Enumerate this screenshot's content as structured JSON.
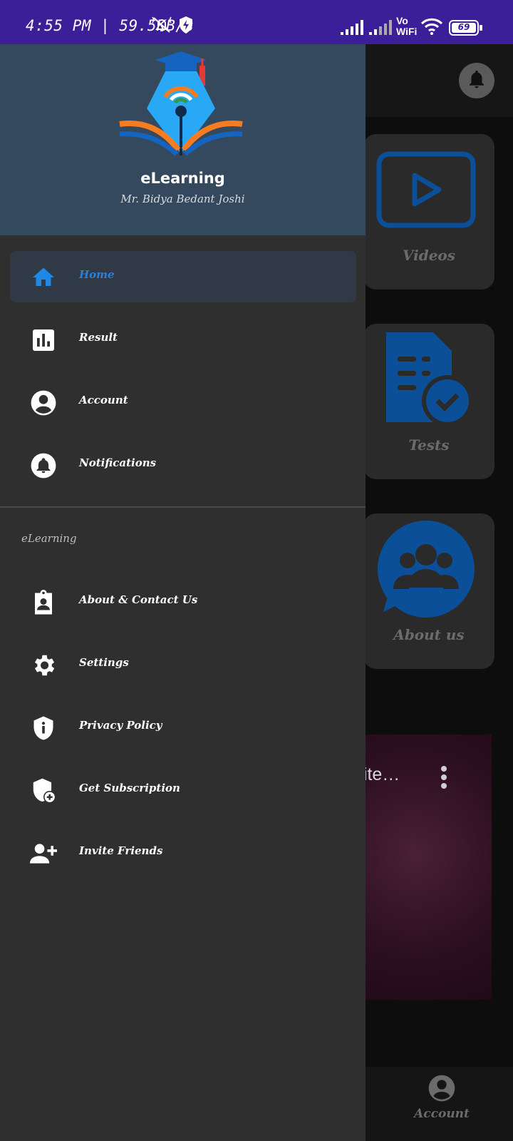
{
  "status_bar": {
    "time": "4:55 PM | 59.5KB/s",
    "network_label_top": "Vo",
    "network_label_bottom": "WiFi",
    "battery": "69",
    "icons": [
      "mute-icon",
      "shield-bolt-icon",
      "signal-icon",
      "signal-icon",
      "wifi-icon",
      "battery-icon"
    ]
  },
  "drawer": {
    "brand": "eLearning",
    "teacher": "Mr. Bidya Bedant Joshi",
    "section_title": "eLearning",
    "main_items": [
      {
        "label": "Home",
        "icon": "home-icon",
        "active": true
      },
      {
        "label": "Result",
        "icon": "bar-chart-icon"
      },
      {
        "label": "Account",
        "icon": "account-circle-icon"
      },
      {
        "label": "Notifications",
        "icon": "bell-icon"
      }
    ],
    "secondary_items": [
      {
        "label": "About & Contact Us",
        "icon": "contact-badge-icon"
      },
      {
        "label": "Settings",
        "icon": "gear-icon"
      },
      {
        "label": "Privacy Policy",
        "icon": "shield-info-icon"
      },
      {
        "label": "Get Subscription",
        "icon": "shield-plus-icon"
      },
      {
        "label": "Invite Friends",
        "icon": "person-add-icon"
      }
    ]
  },
  "background": {
    "tiles": [
      {
        "label": "Videos",
        "icon": "play-video-icon"
      },
      {
        "label": "Tests",
        "icon": "test-document-icon"
      },
      {
        "label": "About us",
        "icon": "group-icon"
      }
    ],
    "video_title": "hite…",
    "bottom_nav": {
      "account_label": "Account"
    }
  },
  "colors": {
    "status_bar": "#3a1f99",
    "drawer": "#2f2f2f",
    "drawer_header": "#34495e",
    "accent_blue": "#2e7fd8",
    "tile_icon_blue": "#0b4f99"
  }
}
